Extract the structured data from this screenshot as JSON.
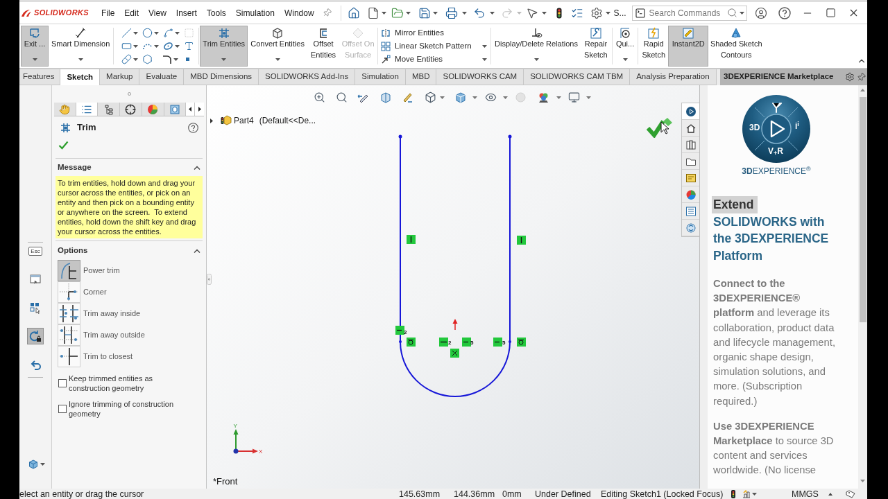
{
  "title_bar": {
    "logo": "SOLIDWORKS",
    "menus": [
      "File",
      "Edit",
      "View",
      "Insert",
      "Tools",
      "Simulation",
      "Window"
    ],
    "overflow_label": "S...",
    "search": {
      "placeholder": "Search Commands"
    }
  },
  "ribbon": {
    "sections": [
      {
        "kind": "buttons",
        "commands": [
          {
            "label": "Exit ...",
            "selected": true,
            "disabled": false,
            "dropdown": true
          },
          {
            "label": "Smart Dimension",
            "selected": false,
            "disabled": false,
            "dropdown": true
          }
        ]
      },
      {
        "kind": "tools"
      },
      {
        "kind": "buttons",
        "commands": [
          {
            "label": "Trim Entities",
            "selected": true,
            "disabled": false,
            "dropdown": true
          },
          {
            "label": "Convert Entities",
            "selected": false,
            "disabled": false,
            "dropdown": true
          },
          {
            "label": "Offset Entities",
            "selected": false,
            "disabled": false,
            "dropdown": false
          },
          {
            "label": "Offset On Surface",
            "selected": false,
            "disabled": true,
            "dropdown": false
          }
        ]
      },
      {
        "kind": "list",
        "commands": [
          {
            "label": "Mirror Entities",
            "dropdown": false
          },
          {
            "label": "Linear Sketch Pattern",
            "dropdown": true
          },
          {
            "label": "Move Entities",
            "dropdown": true
          }
        ]
      },
      {
        "kind": "buttons",
        "commands": [
          {
            "label": "Display/Delete Relations",
            "selected": false,
            "disabled": false,
            "dropdown": true
          },
          {
            "label": "Repair Sketch",
            "selected": false,
            "disabled": false,
            "dropdown": false
          }
        ]
      },
      {
        "kind": "buttons",
        "commands": [
          {
            "label": "Qui...",
            "selected": false,
            "disabled": false,
            "dropdown": true
          }
        ]
      },
      {
        "kind": "buttons",
        "commands": [
          {
            "label": "Rapid Sketch",
            "selected": false,
            "disabled": false,
            "dropdown": false
          },
          {
            "label": "Instant2D",
            "selected": true,
            "disabled": false,
            "dropdown": false
          },
          {
            "label": "Shaded Sketch Contours",
            "selected": false,
            "disabled": false,
            "dropdown": false
          }
        ]
      }
    ]
  },
  "tabs": [
    {
      "label": "Features",
      "selected": false
    },
    {
      "label": "Sketch",
      "selected": true
    },
    {
      "label": "Markup",
      "selected": false
    },
    {
      "label": "Evaluate",
      "selected": false
    },
    {
      "label": "MBD Dimensions",
      "selected": false
    },
    {
      "label": "SOLIDWORKS Add-Ins",
      "selected": false
    },
    {
      "label": "Simulation",
      "selected": false
    },
    {
      "label": "MBD",
      "selected": false
    },
    {
      "label": "SOLIDWORKS CAM",
      "selected": false
    },
    {
      "label": "SOLIDWORKS CAM TBM",
      "selected": false
    },
    {
      "label": "Analysis Preparation",
      "selected": false
    }
  ],
  "left_toolbar": [
    {
      "kind": "esc",
      "label": "Esc",
      "selected": false
    },
    {
      "kind": "window",
      "selected": false
    },
    {
      "kind": "grid",
      "selected": false
    },
    {
      "kind": "lock",
      "selected": true
    },
    {
      "kind": "undo",
      "selected": false
    }
  ],
  "property_manager": {
    "tabs": [
      {
        "selected": false
      },
      {
        "selected": true
      },
      {
        "selected": false
      },
      {
        "selected": false
      },
      {
        "selected": false
      },
      {
        "selected": false
      }
    ],
    "title": "Trim",
    "message": {
      "header": "Message",
      "expanded": true,
      "text": "To trim entities, hold down and drag your cursor across the entities, or pick on an entity and then pick on a bounding entity or anywhere on the screen.  To extend entities, hold down the shift key and drag your cursor across the entities."
    },
    "options": {
      "header": "Options",
      "expanded": true,
      "items": [
        {
          "label": "Power trim",
          "selected": true
        },
        {
          "label": "Corner",
          "selected": false
        },
        {
          "label": "Trim away inside",
          "selected": false
        },
        {
          "label": "Trim away outside",
          "selected": false
        },
        {
          "label": "Trim to closest",
          "selected": false
        }
      ],
      "checkboxes": [
        {
          "label": "Keep trimmed entities as construction geometry",
          "checked": false
        },
        {
          "label": "Ignore trimming of construction geometry",
          "checked": false
        }
      ]
    }
  },
  "graphics_area": {
    "tree": {
      "name": "Part4",
      "configuration": "(Default<<De..."
    },
    "sketch": {
      "relation_numbers": [
        "2",
        "2",
        "5",
        "5"
      ]
    },
    "triad": {
      "x_label": "X",
      "y_label": "Y"
    },
    "view_name": "*Front"
  },
  "task_pane": {
    "tabs": [
      {
        "selected": true
      },
      {
        "selected": false
      },
      {
        "selected": false
      },
      {
        "selected": false
      },
      {
        "selected": false
      },
      {
        "selected": false
      },
      {
        "selected": false
      },
      {
        "selected": false
      }
    ],
    "title": "3DEXPERIENCE Marketplace",
    "logo": {
      "left": "3D",
      "right": "i$^{i}$",
      "bottom": "V$_{+}$R",
      "wordmark": "**3D**EXPERIENCE$^{®}$"
    },
    "heading": [
      {
        "text": "Extend",
        "highlighted": true
      },
      {
        "text": "SOLIDWORKS with the 3DEXPERIENCE Platform",
        "highlighted": false
      }
    ],
    "paragraphs": [
      "**Connect to the 3DEXPERIENCE® platform** and leverage its collaboration, product data and lifecycle management, organic shape design, simulation solutions, and more. (Subscription required.)",
      "**Use 3DEXPERIENCE Marketplace** to source 3D content and services worldwide. (No license"
    ]
  },
  "status_bar": {
    "message": "elect an entity or drag the cursor",
    "coordinates": [
      "145.63mm",
      "144.36mm",
      "0mm"
    ],
    "sketch_state": "Under Defined",
    "editing": "Editing Sketch1 (Locked Focus)",
    "units": "MMGS"
  }
}
